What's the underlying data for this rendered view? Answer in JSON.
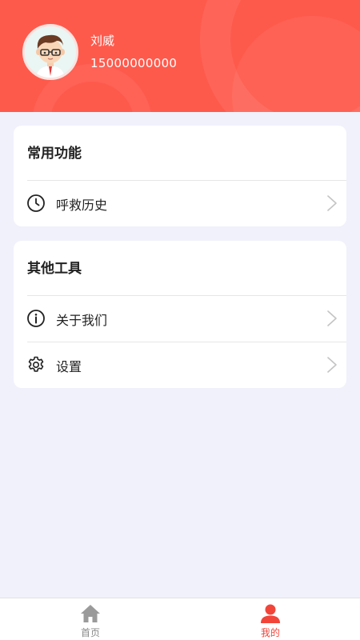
{
  "profile": {
    "name": "刘威",
    "phone": "15000000000"
  },
  "sections": [
    {
      "title": "常用功能",
      "items": [
        {
          "label": "呼救历史",
          "icon": "clock-icon"
        }
      ]
    },
    {
      "title": "其他工具",
      "items": [
        {
          "label": "关于我们",
          "icon": "info-icon"
        },
        {
          "label": "设置",
          "icon": "gear-icon"
        }
      ]
    }
  ],
  "tabbar": {
    "home_label": "首页",
    "mine_label": "我的"
  },
  "colors": {
    "header_bg": "#fe5a4c",
    "active_tab": "#f2453a",
    "inactive_tab": "#8a8a8a",
    "page_bg": "#f0f1fb"
  }
}
